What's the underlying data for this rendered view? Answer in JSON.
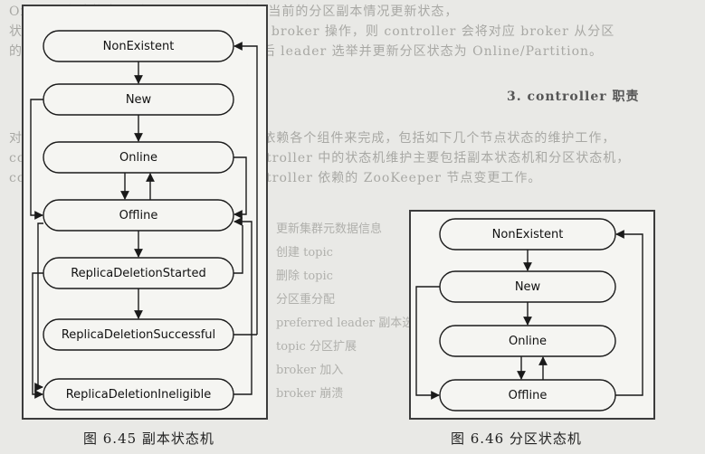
{
  "page": {
    "lines": [
      "Offline 离线状态，则 controller 会查询当前的分区副本情况更新状态，",
      "状态被置为 NonExistent，同时触发相应 broker 操作，则 controller 会将对应 broker 从分区",
      "的 leader，分区状态变更为 Online，随后 leader 选举并更新分区状态为 Online/Partition。",
      "3. controller 职责",
      "对集群中各服务的节点状态，controller 依赖各个组件来完成，包括如下几个节点状态的维护工作，",
      "controller 的职责如下，随后会根据 controller 中的状态机维护主要包括副本状态机和分区状态机，",
      "controller 还要监听若干状态，包括 controller 依赖的 ZooKeeper 节点变更工作。"
    ],
    "bullets": [
      "更新集群元数据信息",
      "创建 topic",
      "删除 topic",
      "分区重分配",
      "preferred leader 副本选举",
      "topic 分区扩展",
      "broker 加入",
      "broker 崩溃"
    ]
  },
  "figure_645": {
    "caption": "图 6.45   副本状态机",
    "states": [
      "NonExistent",
      "New",
      "Online",
      "Offline",
      "ReplicaDeletionStarted",
      "ReplicaDeletionSuccessful",
      "ReplicaDeletionIneligible"
    ]
  },
  "figure_646": {
    "caption": "图 6.46   分区状态机",
    "states": [
      "NonExistent",
      "New",
      "Online",
      "Offline"
    ]
  },
  "colors": {
    "stroke": "#1a1a1a",
    "frame": "#3c3c3c",
    "paper": "#f5f5f2"
  }
}
